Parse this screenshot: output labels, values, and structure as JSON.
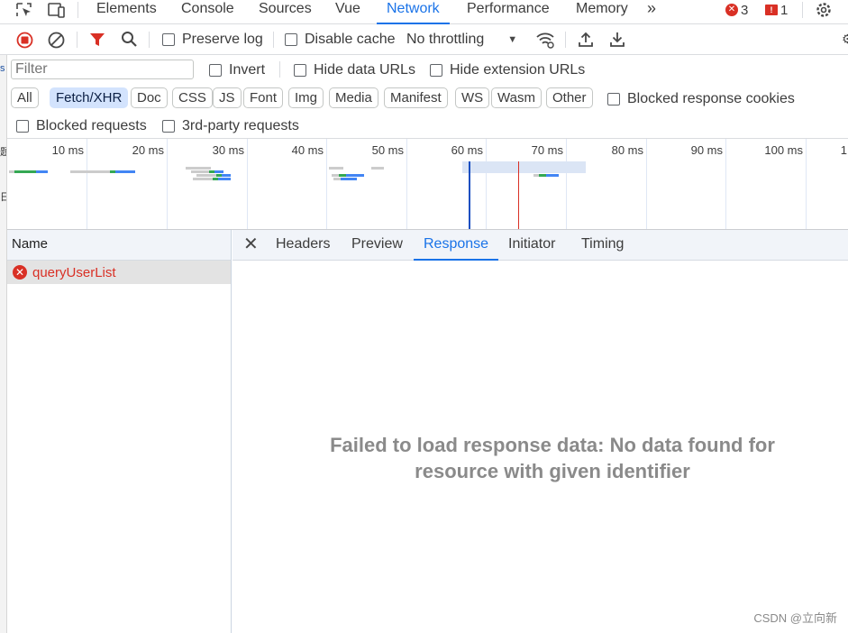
{
  "topbar": {
    "tabs": [
      "Elements",
      "Console",
      "Sources",
      "Vue",
      "Network",
      "Performance",
      "Memory"
    ],
    "active_tab": "Network",
    "more": "»",
    "errors": "3",
    "issues": "1"
  },
  "toolbar": {
    "preserve_log": "Preserve log",
    "disable_cache": "Disable cache",
    "throttling": "No throttling"
  },
  "filters": {
    "placeholder": "Filter",
    "invert": "Invert",
    "hide_data_urls": "Hide data URLs",
    "hide_extension_urls": "Hide extension URLs",
    "types": [
      "All",
      "Fetch/XHR",
      "Doc",
      "CSS",
      "JS",
      "Font",
      "Img",
      "Media",
      "Manifest",
      "WS",
      "Wasm",
      "Other"
    ],
    "active_type": "Fetch/XHR",
    "blocked_cookies": "Blocked response cookies",
    "blocked_requests": "Blocked requests",
    "third_party": "3rd-party requests"
  },
  "overview": {
    "ticks": [
      "10 ms",
      "20 ms",
      "30 ms",
      "40 ms",
      "50 ms",
      "60 ms",
      "70 ms",
      "80 ms",
      "90 ms",
      "100 ms",
      "1"
    ]
  },
  "requests": {
    "header": "Name",
    "rows": [
      {
        "name": "queryUserList",
        "status": "error"
      }
    ]
  },
  "details": {
    "tabs": [
      "Headers",
      "Preview",
      "Response",
      "Initiator",
      "Timing"
    ],
    "active_tab": "Response",
    "message_line1": "Failed to load response data: No data found for",
    "message_line2": "resource with given identifier"
  },
  "watermark": "CSDN @立向新",
  "colors": {
    "accent": "#1a73e8",
    "error": "#d93025",
    "selected_chip": "#d3e3fd"
  }
}
